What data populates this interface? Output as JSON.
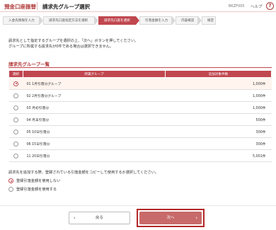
{
  "header": {
    "app_title": "預金口座振替",
    "page_title": "請求先グループ選択",
    "screen_id": "BKZF005",
    "help_label": "ヘルプ",
    "help_icon": "?"
  },
  "steps": [
    {
      "label": "入金先情報を入力",
      "active": false
    },
    {
      "label": "請求先口座指定方法を選択",
      "active": false
    },
    {
      "label": "請求先口座を選択",
      "active": true
    },
    {
      "label": "引落金額を入力",
      "active": false
    },
    {
      "label": "内容確認",
      "active": false
    },
    {
      "label": "確定",
      "active": false
    }
  ],
  "instructions": {
    "line1": "請求先として指定するグループを選択の上、「次へ」ボタンを押してください。",
    "line2": "グループに所属する請求先が0件である場合は選択できません。"
  },
  "group_section": {
    "title": "請求先グループ一覧",
    "columns": {
      "select": "選択",
      "group": "所属グループ",
      "count": "追加対象件数"
    },
    "rows": [
      {
        "name": "01 1月引落分グループ",
        "count": "1,000件",
        "selected": true
      },
      {
        "name": "02 2月引落分グループ",
        "count": "1,000件",
        "selected": false
      },
      {
        "name": "03 月初引落分",
        "count": "1,000件",
        "selected": false
      },
      {
        "name": "04 月末引落分",
        "count": "500件",
        "selected": false
      },
      {
        "name": "05 10日引落分",
        "count": "300件",
        "selected": false
      },
      {
        "name": "06 15日引落分",
        "count": "300件",
        "selected": false
      },
      {
        "name": "11 20日引落分",
        "count": "5,001件",
        "selected": false
      }
    ]
  },
  "copy_option": {
    "question": "請求先を追加する際、登録されている引落金額をコピーして使用するか選択してください。",
    "options": [
      {
        "label": "登録引落金額を使用しない",
        "selected": true
      },
      {
        "label": "登録引落金額を使用する",
        "selected": false
      }
    ]
  },
  "buttons": {
    "back": "戻る",
    "next": "次へ",
    "back_chevron": "‹",
    "next_chevron": "›"
  },
  "colors": {
    "brand": "#b23a3a",
    "active_step": "#c0474f",
    "next_button": "#c86a6a"
  }
}
